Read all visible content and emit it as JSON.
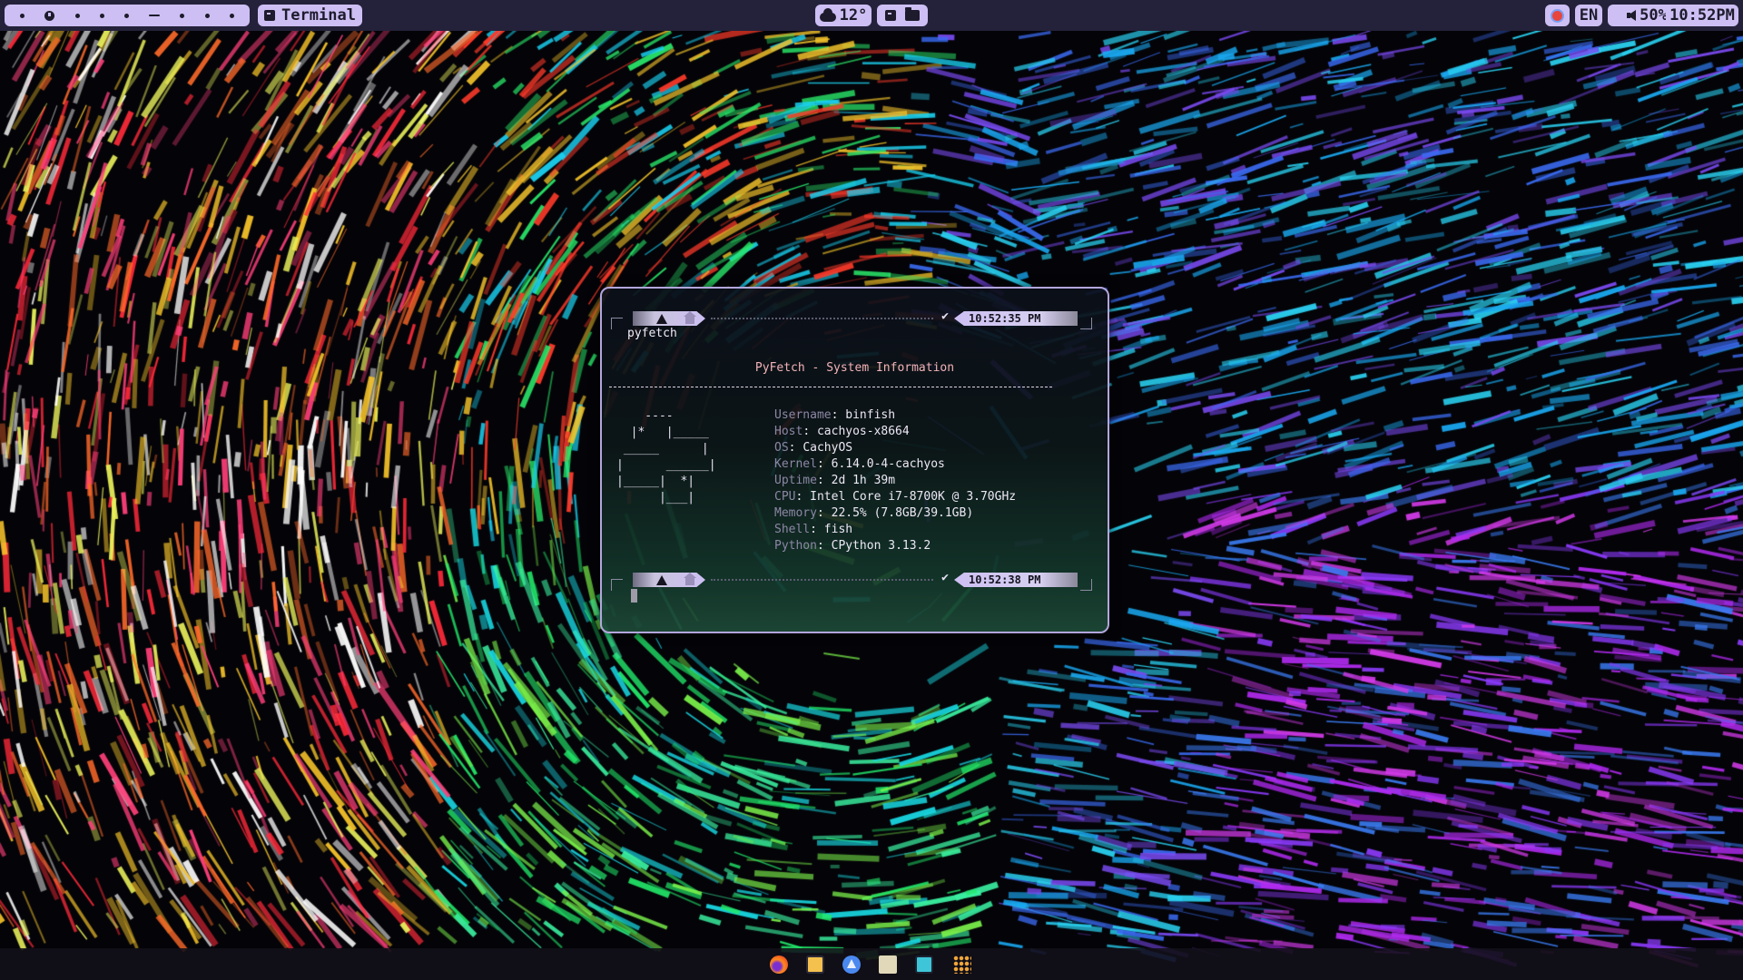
{
  "topbar": {
    "workspaces": {
      "count": 9,
      "active_index": 1
    },
    "window_title": "Terminal",
    "weather": "12°",
    "language": "EN",
    "volume": "50%",
    "clock": "10:52PM"
  },
  "terminal": {
    "prompt1": {
      "time": "10:52:35 PM",
      "status": "✔"
    },
    "command": "pyfetch",
    "header": "PyFetch - System Information",
    "separator": "----------------------------------------------------------------------",
    "ascii_art": "    ----\n  |*   |_____\n _____      |\n|      ______|\n|_____|  *|\n      |___|",
    "info": [
      {
        "key": "Username",
        "value": "binfish"
      },
      {
        "key": "Host",
        "value": "cachyos-x8664"
      },
      {
        "key": "OS",
        "value": "CachyOS"
      },
      {
        "key": "Kernel",
        "value": "6.14.0-4-cachyos"
      },
      {
        "key": "Uptime",
        "value": "2d 1h 39m"
      },
      {
        "key": "CPU",
        "value": "Intel Core i7-8700K  @ 3.70GHz"
      },
      {
        "key": "Memory",
        "value": "22.5% (7.8GB/39.1GB)"
      },
      {
        "key": "Shell",
        "value": "fish"
      },
      {
        "key": "Python",
        "value": "CPython 3.13.2"
      }
    ],
    "prompt2": {
      "time": "10:52:38 PM",
      "status": "✔"
    }
  },
  "dock": {
    "icons": [
      "firefox-icon",
      "text-editor-icon",
      "arch-installer-icon",
      "file-manager-icon",
      "terminal-icon",
      "app-grid-icon"
    ]
  },
  "colors": {
    "bar_bg": "#24223a",
    "pill_bg": "#cdbff3",
    "terminal_border": "#b3a6dc",
    "header_text": "#f2b3b8",
    "info_key": "#8d87a6"
  }
}
